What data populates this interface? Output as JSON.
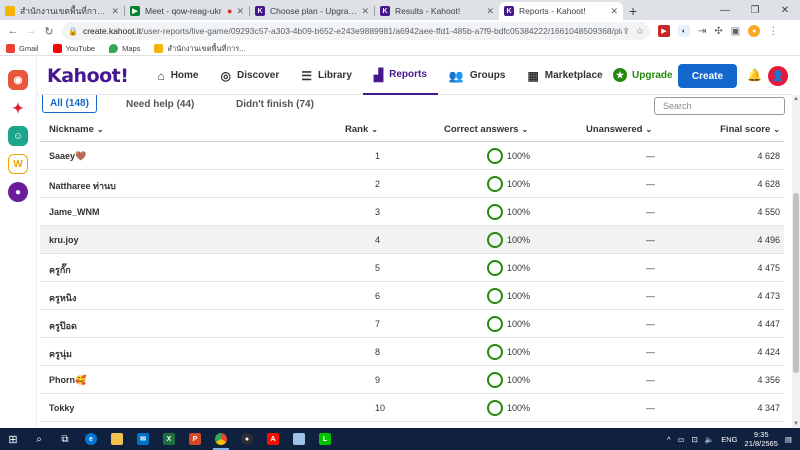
{
  "browser": {
    "tabs": [
      {
        "title": "สำนักงานเขตพื้นที่การศึกษาประถ",
        "favicon_color": "#f4b400"
      },
      {
        "title": "Meet - qow-reag-ukr",
        "favicon_color": "#00832d"
      },
      {
        "title": "Choose plan - Upgrade - Kah",
        "favicon_color": "#46178f"
      },
      {
        "title": "Results - Kahoot!",
        "favicon_color": "#46178f"
      },
      {
        "title": "Reports - Kahoot!",
        "favicon_color": "#46178f"
      }
    ],
    "url_host": "create.kahoot.it",
    "url_path": "/user-reports/live-game/09293c57-a303-4b09-b652-e243e9889981/a6942aee-ffd1-485b-a7f9-bdfc05384222/1661048509368/players/?t...",
    "bookmarks": [
      "Gmail",
      "YouTube",
      "Maps",
      "สำนักงานเขตพื้นที่การ..."
    ]
  },
  "kahoot": {
    "logo": "Kahoot!",
    "nav": [
      {
        "label": "Home",
        "icon": "home-icon"
      },
      {
        "label": "Discover",
        "icon": "compass-icon"
      },
      {
        "label": "Library",
        "icon": "list-icon"
      },
      {
        "label": "Reports",
        "icon": "chart-icon"
      },
      {
        "label": "Groups",
        "icon": "people-icon"
      },
      {
        "label": "Marketplace",
        "icon": "store-icon"
      }
    ],
    "upgrade_label": "Upgrade",
    "create_label": "Create",
    "accent_color": "#46178f",
    "green": "#26890c",
    "blue": "#1368ce"
  },
  "filters": {
    "all": "All (148)",
    "need_help": "Need help (44)",
    "didnt_finish": "Didn't finish (74)",
    "search_placeholder": "Search"
  },
  "table": {
    "headers": {
      "nickname": "Nickname",
      "rank": "Rank",
      "correct": "Correct answers",
      "unanswered": "Unanswered",
      "final_score": "Final score"
    },
    "rows": [
      {
        "nickname": "Saaey🤎",
        "rank": "1",
        "correct": "100%",
        "unanswered": "—",
        "score": "4 628"
      },
      {
        "nickname": "Nattharee ท่านบ",
        "rank": "2",
        "correct": "100%",
        "unanswered": "—",
        "score": "4 628"
      },
      {
        "nickname": "Jame_WNM",
        "rank": "3",
        "correct": "100%",
        "unanswered": "—",
        "score": "4 550"
      },
      {
        "nickname": "kru.joy",
        "rank": "4",
        "correct": "100%",
        "unanswered": "—",
        "score": "4 496"
      },
      {
        "nickname": "ครูกั๊ก",
        "rank": "5",
        "correct": "100%",
        "unanswered": "—",
        "score": "4 475"
      },
      {
        "nickname": "ครูหนิง",
        "rank": "6",
        "correct": "100%",
        "unanswered": "—",
        "score": "4 473"
      },
      {
        "nickname": "ครูป๊อด",
        "rank": "7",
        "correct": "100%",
        "unanswered": "—",
        "score": "4 447"
      },
      {
        "nickname": "ครูนุ่ม",
        "rank": "8",
        "correct": "100%",
        "unanswered": "—",
        "score": "4 424"
      },
      {
        "nickname": "Phorn🥰",
        "rank": "9",
        "correct": "100%",
        "unanswered": "—",
        "score": "4 356"
      },
      {
        "nickname": "Tokky",
        "rank": "10",
        "correct": "100%",
        "unanswered": "—",
        "score": "4 347"
      }
    ]
  },
  "taskbar": {
    "language": "ENG",
    "time": "9:35",
    "date": "21/8/2565"
  }
}
